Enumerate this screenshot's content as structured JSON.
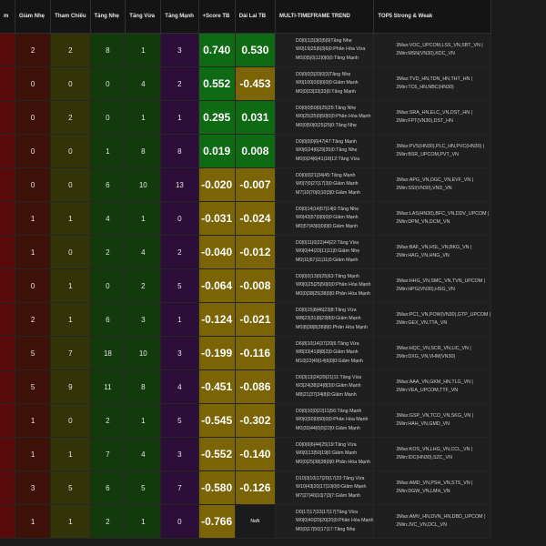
{
  "headers": [
    "m",
    "Giảm Nhẹ",
    "Tham Chiếu",
    "Tăng Nhẹ",
    "Tăng Vừa",
    "Tăng Mạnh",
    "+Score TB",
    "Dài Lai TB",
    "MULTI-TIMEFRAME TREND",
    "TOP5 Strong & Weak"
  ],
  "rows": [
    {
      "a": "",
      "b": "2",
      "c": "2",
      "d": "8",
      "e": "1",
      "f": "3",
      "score": "0.740",
      "dl": "0.530",
      "score_s": "pos",
      "dl_s": "pos",
      "trend": [
        "D0|0|1|3|3|0|6|9|Tăng Nhẹ",
        "W0|19|25|6|3|6|0:Phân Hóa Vừa",
        "M0|0|5|0|12|0|0|0:Tăng Mạnh"
      ],
      "top": [
        "3Max:VOC_UPCOM,LSS_VN,SBT_VN |",
        "2Min:MSN(VN30),KDC_VN"
      ]
    },
    {
      "a": "",
      "b": "0",
      "c": "0",
      "d": "0",
      "e": "4",
      "f": "2",
      "score": "0.552",
      "dl": "-0.453",
      "score_s": "pos",
      "dl_s": "neg",
      "trend": [
        "D0|0|0|3|33|0|3|Tăng Nhẹ",
        "W0|100|0|0|0|0|0:Giảm Mạnh",
        "M0|0|33|33|33|0:Tăng Mạnh"
      ],
      "top": [
        "3Max:TVD_HN,TDN_HN,THT_HN |",
        "2Min:TC6_HN,NBC(HN30)"
      ]
    },
    {
      "a": "",
      "b": "0",
      "c": "2",
      "d": "0",
      "e": "1",
      "f": "1",
      "score": "0.295",
      "dl": "0.031",
      "score_s": "pos",
      "dl_s": "pos",
      "trend": [
        "D0|0|0|50|0|25|25:Tăng Nhẹ",
        "W0|25|25|0|50|0|0:Phân Hóa Mạnh",
        "M0|0|50|0|25|25|0:Tăng Nhẹ"
      ],
      "top": [
        "3Max:SRA_HN,ELC_VN,DST_HN |",
        "2Min:FPT(VN30),DST_HN"
      ]
    },
    {
      "a": "",
      "b": "0",
      "c": "0",
      "d": "1",
      "e": "8",
      "f": "8",
      "score": "0.019",
      "dl": "0.008",
      "score_s": "pos",
      "dl_s": "pos",
      "trend": [
        "D0|0|0|0|6|47|47:Tăng Mạnh",
        "W0|6|24|6|29|35|0:Tăng Nhẹ",
        "M0|0|24|6|41|18|12:Tăng Vừa"
      ],
      "top": [
        "3Max:PVS(HN30),PLC_HN,PVC(HN30) |",
        "2Min:BSR_UPCOM,PVT_VN"
      ]
    },
    {
      "a": "",
      "b": "0",
      "c": "0",
      "d": "6",
      "e": "10",
      "f": "13",
      "score": "-0.020",
      "dl": "-0.007",
      "score_s": "neg",
      "dl_s": "neg",
      "trend": [
        "D0|0|0|21|34|45:Tăng Mạnh",
        "W0|7|0|27|17|3|0:Giảm Mạnh",
        "M7|10|70|0|10|3|0:Giảm Mạnh"
      ],
      "top": [
        "3Max:APG_VN,OGC_VN,EVF_VN |",
        "2Min:SSI(VN30),VND_VN"
      ]
    },
    {
      "a": "",
      "b": "1",
      "c": "1",
      "d": "4",
      "e": "1",
      "f": "0",
      "score": "-0.031",
      "dl": "-0.024",
      "score_s": "neg",
      "dl_s": "neg",
      "trend": [
        "D0|0|14|14|57|14|0:Tăng Nhẹ",
        "W0|43|57|0|0|0|0:Giảm Mạnh",
        "M0|57|43|0|0|0|0:Giảm Mạnh"
      ],
      "top": [
        "3Max:LAS(HN30),BFC_VN,DDV_UPCOM |",
        "2Min:DPM_VN,DCM_VN"
      ]
    },
    {
      "a": "",
      "b": "1",
      "c": "0",
      "d": "2",
      "e": "4",
      "f": "2",
      "score": "-0.040",
      "dl": "-0.012",
      "score_s": "neg",
      "dl_s": "neg",
      "trend": [
        "D0|0|11|0|22|44|22:Tăng Vừa",
        "W0|0|44|33|11|11|0:Giảm Nhẹ",
        "M0|11|67|11|11|0:Giảm Mạnh"
      ],
      "top": [
        "3Max:BAF_VN,HSL_VN,BKG_VN |",
        "2Min:HAG_VN,HNG_VN"
      ]
    },
    {
      "a": "",
      "b": "0",
      "c": "1",
      "d": "0",
      "e": "2",
      "f": "5",
      "score": "-0.064",
      "dl": "-0.008",
      "score_s": "neg",
      "dl_s": "neg",
      "trend": [
        "D0|0|0|13|0|25|63:Tăng Mạnh",
        "W0|0|25|25|50|0|0:Phân Hóa Mạnh",
        "M0|0|38|25|38|0|0:Phân Hóa Mạnh"
      ],
      "top": [
        "3Max:HHG_VN,SMC_VN,TVN_UPCOM |",
        "2Min:HPG(VN30),HSG_VN"
      ]
    },
    {
      "a": "",
      "b": "2",
      "c": "1",
      "d": "6",
      "e": "3",
      "f": "1",
      "score": "-0.124",
      "dl": "-0.021",
      "score_s": "neg",
      "dl_s": "neg",
      "trend": [
        "D0|0|15|8|46|23|8:Tăng Vừa",
        "W8|23|31|8|23|8|0:Giảm Mạnh",
        "M0|8|38|8|38|8|0:Phân Hóa Mạnh"
      ],
      "top": [
        "3Max:PC1_VN,POW(VN30),GTP_UPCOM |",
        "2Min:GEX_VN,TTA_VN"
      ]
    },
    {
      "a": "",
      "b": "5",
      "c": "7",
      "d": "18",
      "e": "10",
      "f": "3",
      "score": "-0.199",
      "dl": "-0.116",
      "score_s": "neg",
      "dl_s": "neg",
      "trend": [
        "D6|8|10|14|37|20|6:Tăng Vừa",
        "W8|33|41|8|8|2|0:Giảm Mạnh",
        "M10|22|49|14|6|0|0:Giảm Mạnh"
      ],
      "top": [
        "3Max:HQC_VN,SCR_VN,LIC_VN |",
        "2Min:DXG_VN,VHM(VN30)"
      ]
    },
    {
      "a": "",
      "b": "5",
      "c": "9",
      "d": "11",
      "e": "8",
      "f": "4",
      "score": "-0.451",
      "dl": "-0.086",
      "score_s": "neg",
      "dl_s": "neg",
      "trend": [
        "D0|3|13|24|29|21|11:Tăng Vừa",
        "W3|24|38|24|8|3|0:Giảm Mạnh",
        "M8|21|37|34|8|0:Giảm Mạnh"
      ],
      "top": [
        "3Max:AAA_VN,GKM_HN,TLG_VN |",
        "2Min:VEA_UPCOM,TTF_VN"
      ]
    },
    {
      "a": "",
      "b": "1",
      "c": "0",
      "d": "2",
      "e": "1",
      "f": "5",
      "score": "-0.545",
      "dl": "-0.302",
      "score_s": "neg",
      "dl_s": "neg",
      "trend": [
        "D0|0|10|0|22|11|56:Tăng Mạnh",
        "W0|0|50|0|50|0|0:Phân Hóa Mạnh",
        "M0|33|44|0|0|22|0:Giảm Mạnh"
      ],
      "top": [
        "3Max:GSP_VN,TCO_VN,SKG_VN |",
        "2Min:HAH_VN,GMD_VN"
      ]
    },
    {
      "a": "",
      "b": "1",
      "c": "1",
      "d": "7",
      "e": "4",
      "f": "3",
      "score": "-0.552",
      "dl": "-0.140",
      "score_s": "neg",
      "dl_s": "neg",
      "trend": [
        "D0|0|6|6|44|25|19:Tăng Vừa",
        "W0|0|13|50|19|0:Giảm Mạnh",
        "M0|0|25|38|38|0|0:Phân Hóa Mạnh"
      ],
      "top": [
        "3Max:KOS_VN,LHG_VN,CCL_VN |",
        "2Min:IDC(HN30),SZC_VN"
      ]
    },
    {
      "a": "",
      "b": "3",
      "c": "5",
      "d": "6",
      "e": "5",
      "f": "7",
      "score": "-0.580",
      "dl": "-0.126",
      "score_s": "neg",
      "dl_s": "neg",
      "trend": [
        "D10|3|10|17|20|17|23:Tăng Vừa",
        "W10|43|20|17|10|0|0:Giảm Mạnh",
        "M7|27|40|10|7|3|7:Giảm Mạnh"
      ],
      "top": [
        "3Max:AMD_VN,PSH_VN,STS_VN |",
        "2Min:DGW_VN,LMH_VN"
      ]
    },
    {
      "a": "",
      "b": "1",
      "c": "1",
      "d": "2",
      "e": "1",
      "f": "0",
      "score": "-0.766",
      "dl": "NaN",
      "score_s": "neg",
      "dl_s": "nodata",
      "trend": [
        "D0|17|17|33|17|17|Tăng Vừa",
        "W0|0|40|20|20|20|0:Phân Hóa Mạnh",
        "M0|0|17|50|17|17:Tăng Nhẹ"
      ],
      "top": [
        "3Max:AMV_HN,DVN_HN,DBD_UPCOM |",
        "2Min:JVC_VN,DCL_VN"
      ]
    }
  ],
  "colors": {
    "positive": "#0f6a14",
    "negative": "#7a6406",
    "empty": "#1b1b1b"
  }
}
